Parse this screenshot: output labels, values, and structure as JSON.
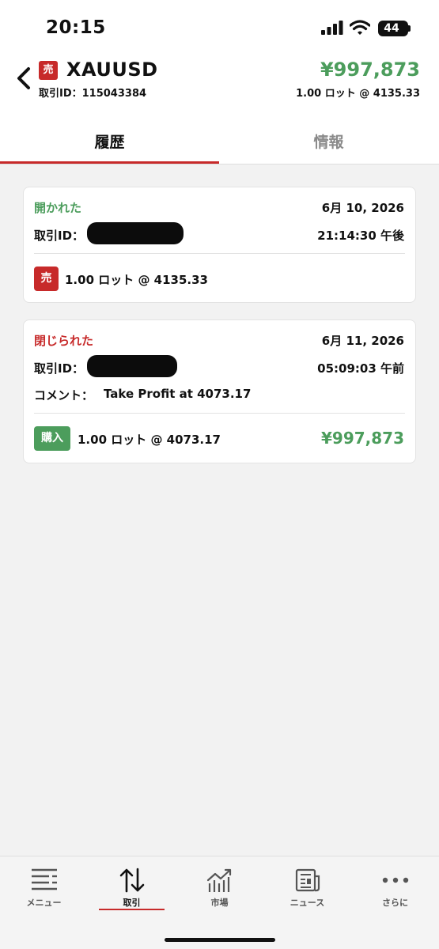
{
  "status_bar": {
    "time": "20:15",
    "battery": "44"
  },
  "header": {
    "side_badge": "売",
    "symbol": "XAUUSD",
    "trade_id": "取引ID：115043384",
    "pnl": "¥997,873",
    "lot_info": "1.00 ロット @ 4135.33"
  },
  "tabs": [
    {
      "label": "履歴",
      "active": true
    },
    {
      "label": "情報",
      "active": false
    }
  ],
  "history": [
    {
      "status": "開かれた",
      "status_color": "#4c9d5c",
      "date": "6月 10, 2026",
      "id_label": "取引ID：",
      "time": "21:14:30 午後",
      "side": "売",
      "side_color": "#c72a2a",
      "lots": "1.00 ロット @ 4135.33"
    },
    {
      "status": "閉じられた",
      "status_color": "#c72a2a",
      "date": "6月 11, 2026",
      "id_label": "取引ID：",
      "time": "05:09:03 午前",
      "comment_label": "コメント：",
      "comment": "Take Profit at 4073.17",
      "side": "購入",
      "side_color": "#4c9d5c",
      "lots": "1.00 ロット @ 4073.17",
      "profit": "¥997,873"
    }
  ],
  "bottom_nav": [
    {
      "label": "メニュー",
      "icon": "menu-icon"
    },
    {
      "label": "取引",
      "icon": "trade-arrows-icon",
      "active": true
    },
    {
      "label": "市場",
      "icon": "market-chart-icon"
    },
    {
      "label": "ニュース",
      "icon": "news-icon"
    },
    {
      "label": "さらに",
      "icon": "more-dots-icon"
    }
  ],
  "colors": {
    "accent_red": "#c72a2a",
    "profit_green": "#4c9d5c"
  }
}
